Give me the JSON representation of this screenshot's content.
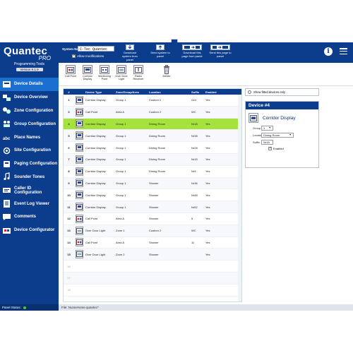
{
  "brand": {
    "name": "Quantec",
    "sub": "PRO",
    "tools": "Programming Tools",
    "version": "Version 9.1.9"
  },
  "sidebar": {
    "items": [
      {
        "label": "Device Details",
        "icon": "device-details-icon",
        "active": true
      },
      {
        "label": "Device Overview",
        "icon": "device-overview-icon"
      },
      {
        "label": "Zone Configuration",
        "icon": "zone-config-icon"
      },
      {
        "label": "Group Configuration",
        "icon": "group-config-icon"
      },
      {
        "label": "Place Names",
        "icon": "place-names-icon"
      },
      {
        "label": "Site Configuration",
        "icon": "site-config-icon"
      },
      {
        "label": "Paging Configuration",
        "icon": "paging-config-icon"
      },
      {
        "label": "Sounder Tones",
        "icon": "music-note-icon"
      },
      {
        "label": "Caller ID Configuration",
        "icon": "caller-id-icon"
      },
      {
        "label": "Event Log Viewer",
        "icon": "event-log-icon"
      },
      {
        "label": "Comments",
        "icon": "comments-icon"
      },
      {
        "label": "Device Configurator",
        "icon": "device-configurator-icon"
      }
    ],
    "panel_status": "Panel Status:",
    "status_color": "#3fcc3f"
  },
  "topbar": {
    "system_name_label": "System Name:",
    "system_name_value": "C-Tec Quantec",
    "allow_modifications": "Allow modifications",
    "actions": [
      {
        "label": "Download system from panel",
        "icon": "download-system-icon"
      },
      {
        "label": "Send system to panel",
        "icon": "send-system-icon"
      },
      {
        "label": "Download this page from panel",
        "icon": "download-page-icon"
      },
      {
        "label": "Send this page to panel",
        "icon": "send-page-icon"
      }
    ]
  },
  "toolbar": {
    "tools": [
      {
        "label": "Call Point",
        "icon": "call-point-icon"
      },
      {
        "label": "Corridor Display",
        "icon": "corridor-display-icon"
      },
      {
        "label": "Monitoring Point",
        "icon": "monitoring-point-icon"
      },
      {
        "label": "Over Door Light",
        "icon": "over-door-light-icon"
      },
      {
        "label": "Radio Receiver",
        "icon": "radio-receiver-icon"
      },
      {
        "label": "Delete",
        "icon": "trash-icon"
      }
    ]
  },
  "table": {
    "columns": [
      "#",
      "Device Type",
      "Zone/Group/Area",
      "Location",
      "Suffix",
      "Enabled"
    ],
    "rows": [
      {
        "num": "1",
        "type": "Corridor Display",
        "zone": "Group 1",
        "location": "Custom 2",
        "suffix": "Grd",
        "enabled": "Yes",
        "kind": "display"
      },
      {
        "num": "3",
        "type": "Call Point",
        "zone": "Area A",
        "location": "Custom 2",
        "suffix": "WC",
        "enabled": "Yes",
        "kind": "callpoint"
      },
      {
        "num": "4",
        "type": "Corridor Display",
        "zone": "Group 1",
        "location": "Dining Room",
        "suffix": "Nr18",
        "enabled": "Yes",
        "kind": "display",
        "selected": true
      },
      {
        "num": "5",
        "type": "Corridor Display",
        "zone": "Group 1",
        "location": "Dining Room",
        "suffix": "Nr38",
        "enabled": "Yes",
        "kind": "display"
      },
      {
        "num": "6",
        "type": "Corridor Display",
        "zone": "Group 1",
        "location": "Dining Room",
        "suffix": "Nr28",
        "enabled": "Yes",
        "kind": "display"
      },
      {
        "num": "7",
        "type": "Corridor Display",
        "zone": "Group 1",
        "location": "Dining Room",
        "suffix": "Nr15",
        "enabled": "Yes",
        "kind": "display"
      },
      {
        "num": "8",
        "type": "Corridor Display",
        "zone": "Group 1",
        "location": "Dining Room",
        "suffix": "Nr5",
        "enabled": "Yes",
        "kind": "display"
      },
      {
        "num": "9",
        "type": "Corridor Display",
        "zone": "Group 1",
        "location": "Shower",
        "suffix": "Nr36",
        "enabled": "Yes",
        "kind": "display"
      },
      {
        "num": "10",
        "type": "Corridor Display",
        "zone": "Group 1",
        "location": "Shower",
        "suffix": "Nr48",
        "enabled": "Yes",
        "kind": "display"
      },
      {
        "num": "11",
        "type": "Corridor Display",
        "zone": "Group 1",
        "location": "Shower",
        "suffix": "Nr52",
        "enabled": "Yes",
        "kind": "display"
      },
      {
        "num": "12",
        "type": "Call Point",
        "zone": "Area A",
        "location": "Shower",
        "suffix": "5",
        "enabled": "Yes",
        "kind": "callpoint"
      },
      {
        "num": "13",
        "type": "Over Door Light",
        "zone": "Zone 1",
        "location": "Custom 2",
        "suffix": "WC",
        "enabled": "Yes",
        "kind": "odl"
      },
      {
        "num": "14",
        "type": "Call Point",
        "zone": "Area A",
        "location": "Shower",
        "suffix": "11",
        "enabled": "Yes",
        "kind": "callpoint"
      },
      {
        "num": "15",
        "type": "Over Door Light",
        "zone": "Zone 2",
        "location": "Shower",
        "suffix": "",
        "enabled": "Yes",
        "kind": "odl"
      },
      {
        "num": "16",
        "empty": true
      },
      {
        "num": "17",
        "empty": true
      },
      {
        "num": "18",
        "empty": true
      }
    ],
    "selected_color": "#a6e23d"
  },
  "right_panel": {
    "show_fitted": "Show fitted devices only",
    "header": "Device #4",
    "device_type": "Corridor Display",
    "group_label": "Group",
    "group_value": "1",
    "location_label": "Location",
    "location_value": "Dining Room",
    "suffix_label": "Suffix",
    "suffix_value": "Nr18",
    "enabled_label": "Enabled"
  },
  "footer": {
    "file": "File: NurseHome.quantec*"
  },
  "colors": {
    "navy": "#0c3c8c",
    "active_nav": "#1a6fd0"
  }
}
